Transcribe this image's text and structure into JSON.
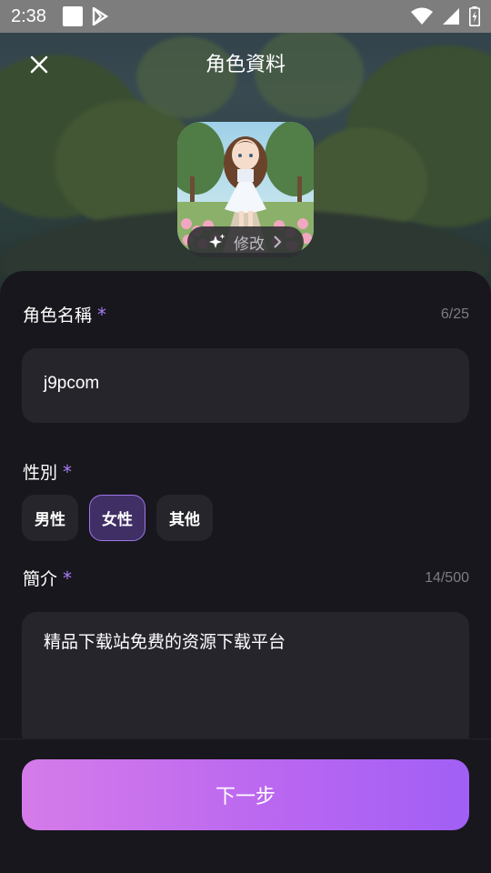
{
  "status_bar": {
    "time": "2:38",
    "icons": [
      "notification-square-icon",
      "play-store-icon",
      "wifi-icon",
      "signal-icon",
      "battery-icon"
    ]
  },
  "header": {
    "title": "角色資料",
    "close_icon": "close-icon"
  },
  "avatar": {
    "edit_label": "修改",
    "edit_icon": "sparkle-icon",
    "chevron_icon": "chevron-right-icon"
  },
  "name_field": {
    "label": "角色名稱",
    "required_mark": "*",
    "counter": "6/25",
    "value": "j9pcom"
  },
  "gender": {
    "label": "性別",
    "required_mark": "*",
    "options": [
      "男性",
      "女性",
      "其他"
    ],
    "selected": "女性"
  },
  "intro_field": {
    "label": "簡介",
    "required_mark": "*",
    "counter": "14/500",
    "value": "精品下载站免费的资源下载平台"
  },
  "footer": {
    "next_label": "下一步"
  },
  "colors": {
    "accent_purple": "#a77cf5",
    "chip_active_bg": "#3f2f64",
    "button_gradient_start": "#d57be9",
    "button_gradient_end": "#a15ff5",
    "sheet_bg": "#18171d",
    "input_bg": "#26252c"
  }
}
